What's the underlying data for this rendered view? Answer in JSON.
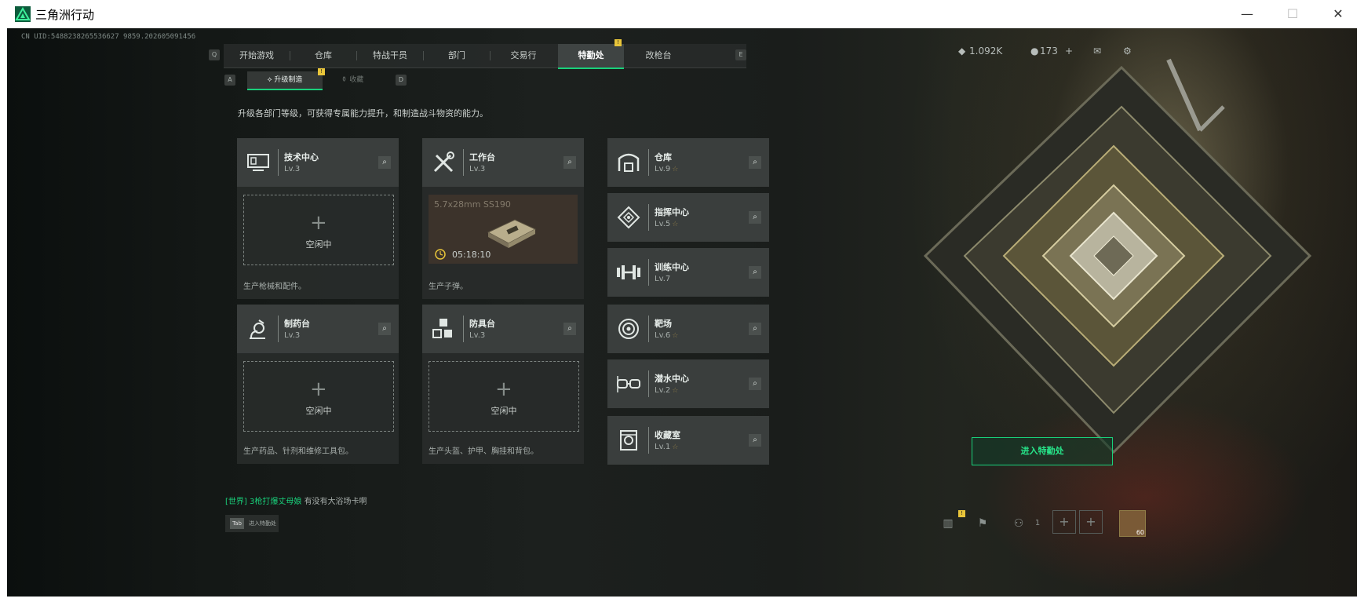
{
  "window": {
    "title": "三角洲行动",
    "minimize": "—",
    "maximize": "☐",
    "close": "✕"
  },
  "cn_uid": "CN UID:5488238265536627 9859.202605091456",
  "top_nav": {
    "left_key": "Q",
    "right_key": "E",
    "tabs": [
      {
        "label": "开始游戏"
      },
      {
        "label": "仓库"
      },
      {
        "label": "特战干员"
      },
      {
        "label": "部门"
      },
      {
        "label": "交易行"
      },
      {
        "label": "特勤处",
        "active": true,
        "badge": "!"
      },
      {
        "label": "改枪台"
      }
    ]
  },
  "status": {
    "currency": "1.092K",
    "coins": "173",
    "plus": "+"
  },
  "sub_nav": {
    "left_key": "A",
    "right_key": "D",
    "tabs": [
      {
        "label": "升级制造",
        "badge": "!"
      },
      {
        "label": "收藏"
      }
    ]
  },
  "description": "升级各部门等级，可获得专属能力提升，和制造战斗物资的能力。",
  "facilities": [
    {
      "name": "技术中心",
      "level": "Lv.3",
      "icon": "computer-icon",
      "slot": "idle",
      "idle_text": "空闲中",
      "desc": "生产枪械和配件。"
    },
    {
      "name": "工作台",
      "level": "Lv.3",
      "icon": "tools-icon",
      "slot": "producing",
      "product": "5.7x28mm SS190",
      "time": "05:18:10",
      "desc": "生产子弹。"
    },
    {
      "name": "制药台",
      "level": "Lv.3",
      "icon": "microscope-icon",
      "slot": "idle",
      "idle_text": "空闲中",
      "desc": "生产药品、针剂和维修工具包。"
    },
    {
      "name": "防具台",
      "level": "Lv.3",
      "icon": "armor-blocks-icon",
      "slot": "idle",
      "idle_text": "空闲中",
      "desc": "生产头盔、护甲、胸挂和背包。"
    }
  ],
  "departments": [
    {
      "name": "仓库",
      "level": "Lv.9",
      "icon": "warehouse-icon",
      "star": "☆"
    },
    {
      "name": "指挥中心",
      "level": "Lv.5",
      "icon": "command-icon",
      "star": "☆"
    },
    {
      "name": "训练中心",
      "level": "Lv.7",
      "icon": "dumbbell-icon",
      "star": ""
    },
    {
      "name": "靶场",
      "level": "Lv.6",
      "icon": "target-icon",
      "star": "☆"
    },
    {
      "name": "潜水中心",
      "level": "Lv.2",
      "icon": "dive-mask-icon",
      "star": "☆"
    },
    {
      "name": "收藏室",
      "level": "Lv.1",
      "icon": "vault-icon",
      "star": "☆"
    }
  ],
  "enter_button": "进入特勤处",
  "chat": {
    "channel": "[世界]",
    "sender": "3枪打爆丈母娘",
    "message": "有没有大浴场卡啊"
  },
  "tab_hint": {
    "key": "Tab",
    "label": "进入特勤处"
  },
  "bottom": {
    "friends_count": "1",
    "avatar_level": "60",
    "badge": "!"
  },
  "colors": {
    "accent": "#19d17b",
    "badge": "#e8c53a",
    "panel": "#3a3e3d"
  }
}
